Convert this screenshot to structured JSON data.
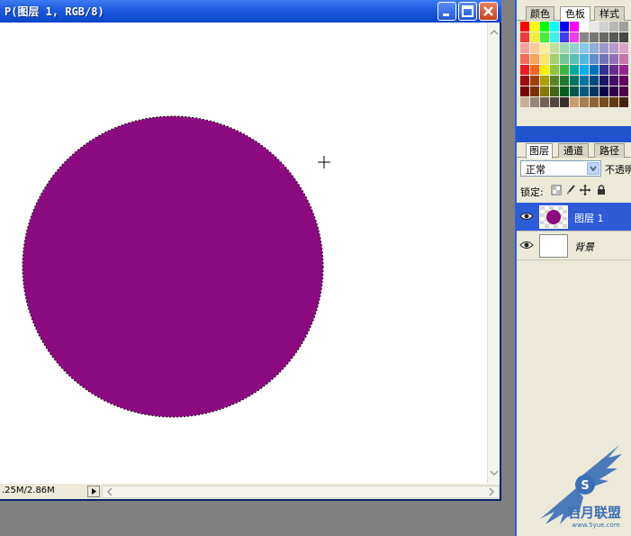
{
  "document": {
    "title": "P(图层 1, RGB/8)",
    "status_size": ".25M/2.86M",
    "fill_color": "#8c0a7f"
  },
  "color_panel": {
    "tabs": [
      {
        "label": "颜色",
        "active": false
      },
      {
        "label": "色板",
        "active": true
      },
      {
        "label": "样式",
        "active": false
      }
    ],
    "swatch_rows": [
      [
        "#ff0000",
        "#ffff00",
        "#00ff00",
        "#00ffff",
        "#0000ff",
        "#ff00ff",
        "#ffffff",
        "#e8e8e8",
        "#d0d0d0",
        "#b8b8b8",
        "#a0a0a0"
      ],
      [
        "#f03c3c",
        "#f0f03c",
        "#3cf03c",
        "#3cf0f0",
        "#3c3cf0",
        "#f03cf0",
        "#888888",
        "#787878",
        "#686868",
        "#585858",
        "#484848"
      ],
      [
        "#f7a19a",
        "#f9c99a",
        "#fbee9c",
        "#c3df9d",
        "#9dd8b5",
        "#8ed3cf",
        "#88c9eb",
        "#8eaedb",
        "#9999cc",
        "#b499c9",
        "#d9a3c9"
      ],
      [
        "#f36d5c",
        "#f7a25f",
        "#fbe46c",
        "#a4d070",
        "#6fc896",
        "#59c0bd",
        "#4eb7e6",
        "#5c8fcc",
        "#7174b8",
        "#9370b3",
        "#c674af"
      ],
      [
        "#ed1c24",
        "#f26522",
        "#fff200",
        "#8dc63f",
        "#39b54a",
        "#00a99d",
        "#00aeef",
        "#0072bc",
        "#2e3192",
        "#662d91",
        "#92278f"
      ],
      [
        "#9e0b0f",
        "#a0410d",
        "#aba000",
        "#598527",
        "#197b30",
        "#00746b",
        "#0076a3",
        "#004a80",
        "#1b1464",
        "#440e62",
        "#630460"
      ],
      [
        "#790000",
        "#7b2e00",
        "#827b00",
        "#406618",
        "#005e20",
        "#005952",
        "#005b7f",
        "#003663",
        "#0d004c",
        "#32004b",
        "#4b0049"
      ],
      [
        "#c7b299",
        "#998675",
        "#736357",
        "#534741",
        "#362f2d",
        "#c69c6d",
        "#a67c52",
        "#8c6239",
        "#754c24",
        "#603913",
        "#42210b"
      ]
    ]
  },
  "layers_panel": {
    "tabs": [
      {
        "label": "图层",
        "active": true
      },
      {
        "label": "通道",
        "active": false
      },
      {
        "label": "路径",
        "active": false
      }
    ],
    "blend_mode": "正常",
    "opacity_label": "不透明",
    "lock_label": "锁定:",
    "layers": [
      {
        "name": "图层 1",
        "selected": true,
        "visible": true,
        "thumb": "purple-circle"
      },
      {
        "name": "背景",
        "selected": false,
        "visible": true,
        "thumb": "white"
      }
    ]
  },
  "watermark": {
    "text": "岩月联盟",
    "subtext": "www.5yue.com"
  }
}
